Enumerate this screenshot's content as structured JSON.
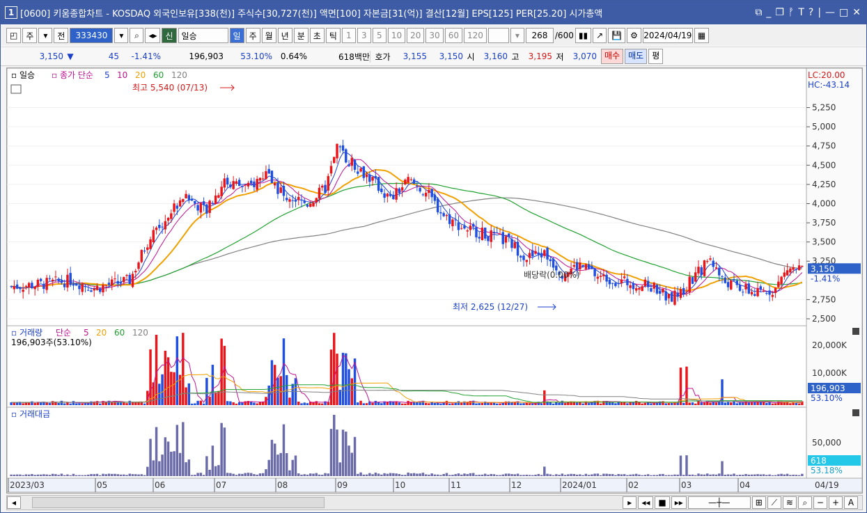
{
  "title": {
    "num": "1",
    "text": "[0600] 키움종합차트 - KOSDAQ 외국인보유[338(천)] 주식수[30,727(천)] 액면[100] 자본금[31(억)] 결산[12월] EPS[125] PER[25.20] 시가총액"
  },
  "toolbar": {
    "market": "주",
    "all": "전",
    "code": "333430",
    "credit_badge": "신",
    "stock_name": "일승",
    "periods": [
      "일",
      "주",
      "월",
      "년",
      "분",
      "초",
      "틱"
    ],
    "minutes": [
      "1",
      "3",
      "5",
      "10",
      "20",
      "30",
      "60",
      "120"
    ],
    "count": "268",
    "count_max": "/600",
    "date": "2024/04/19"
  },
  "quote": {
    "price": "3,150",
    "arrow": "▼",
    "change": "45",
    "change_rate": "-1.41%",
    "volume": "196,903",
    "volume_rate": "53.10%",
    "turnover": "0.64%",
    "amount": "618백만",
    "ask_label": "호가",
    "ask": "3,155",
    "bid": "3,150",
    "open_label": "시",
    "open": "3,160",
    "high_label": "고",
    "high": "3,195",
    "low_label": "저",
    "low": "3,070",
    "buy_btn": "매수",
    "sell_btn": "매도",
    "eval_btn": "평"
  },
  "price_panel": {
    "name": "일승",
    "ma_label": "종가 단순",
    "ma_periods": [
      "5",
      "10",
      "20",
      "60",
      "120"
    ],
    "max_note": "최고 5,540 (07/13)",
    "min_note": "최저 2,625 (12/27)",
    "dividend_note": "배당락(0.00%)",
    "lc": "LC:20.00",
    "hc": "HC:-43.14",
    "last_price": "3,150",
    "last_rate": "-1.41%",
    "y_ticks": [
      "5,250",
      "5,000",
      "4,750",
      "4,500",
      "4,250",
      "4,000",
      "3,750",
      "3,500",
      "3,250",
      "2,750",
      "2,500"
    ]
  },
  "volume_panel": {
    "name": "거래량",
    "ma_label": "단순",
    "ma_periods": [
      "5",
      "20",
      "60",
      "120"
    ],
    "current": "196,903주(53.10%)",
    "y_ticks": [
      "20,000K",
      "10,000K"
    ],
    "last_value": "196,903",
    "last_rate": "53.10%"
  },
  "amount_panel": {
    "name": "거래대금",
    "y_ticks": [
      "50,000"
    ],
    "last_value": "618",
    "last_rate": "53.18%"
  },
  "x_axis": [
    "2023/03",
    "05",
    "06",
    "07",
    "08",
    "09",
    "10",
    "11",
    "12",
    "2024/01",
    "02",
    "03",
    "04"
  ],
  "x_last": "04/19",
  "colors": {
    "up": "#e8161b",
    "down": "#1f4fe0",
    "ma5": "#1f3fd0",
    "ma10": "#c01090",
    "ma20": "#f0a000",
    "ma60": "#20a030",
    "ma120": "#808080",
    "amount": "#6a6aa8",
    "title_bg": "#3e5ba5"
  }
}
